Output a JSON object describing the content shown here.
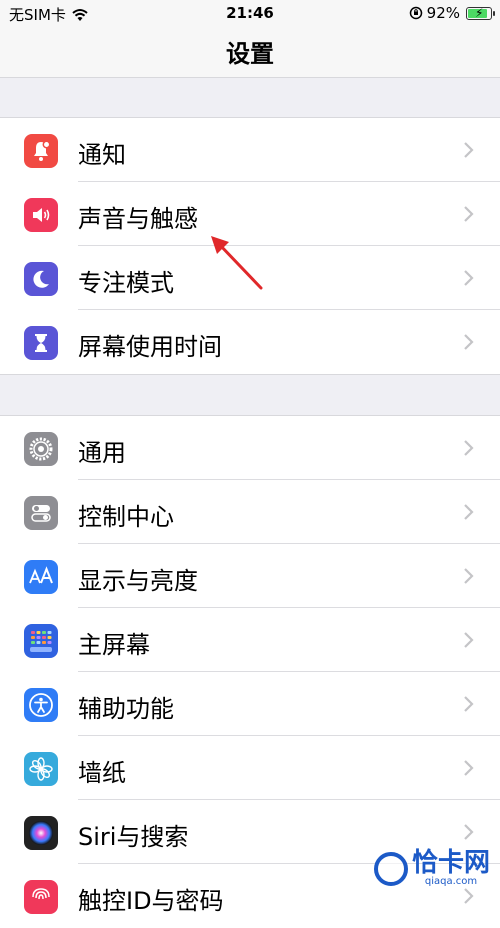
{
  "status_bar": {
    "carrier": "无SIM卡",
    "time": "21:46",
    "battery": "92%",
    "battery_level": 0.92
  },
  "nav": {
    "title": "设置"
  },
  "groups": [
    {
      "items": [
        {
          "label": "通知",
          "icon": "bell-icon",
          "color": "#f14a43"
        },
        {
          "label": "声音与触感",
          "icon": "speaker-icon",
          "color": "#f0385a"
        },
        {
          "label": "专注模式",
          "icon": "moon-icon",
          "color": "#5a55d6"
        },
        {
          "label": "屏幕使用时间",
          "icon": "hourglass-icon",
          "color": "#5a55d6"
        }
      ]
    },
    {
      "items": [
        {
          "label": "通用",
          "icon": "gear-icon",
          "color": "#8e8e93"
        },
        {
          "label": "控制中心",
          "icon": "toggles-icon",
          "color": "#8e8e93"
        },
        {
          "label": "显示与亮度",
          "icon": "text-size-icon",
          "color": "#2f7cf6"
        },
        {
          "label": "主屏幕",
          "icon": "home-grid-icon",
          "color": "#2f62e0"
        },
        {
          "label": "辅助功能",
          "icon": "accessibility-icon",
          "color": "#2f7cf6"
        },
        {
          "label": "墙纸",
          "icon": "flower-icon",
          "color": "#36aadc"
        },
        {
          "label": "Siri与搜索",
          "icon": "siri-icon",
          "color": "#222222"
        },
        {
          "label": "触控ID与密码",
          "icon": "fingerprint-icon",
          "color": "#f0385a"
        }
      ]
    }
  ],
  "watermark": {
    "name": "恰卡网",
    "domain": "qiaqa.com"
  }
}
